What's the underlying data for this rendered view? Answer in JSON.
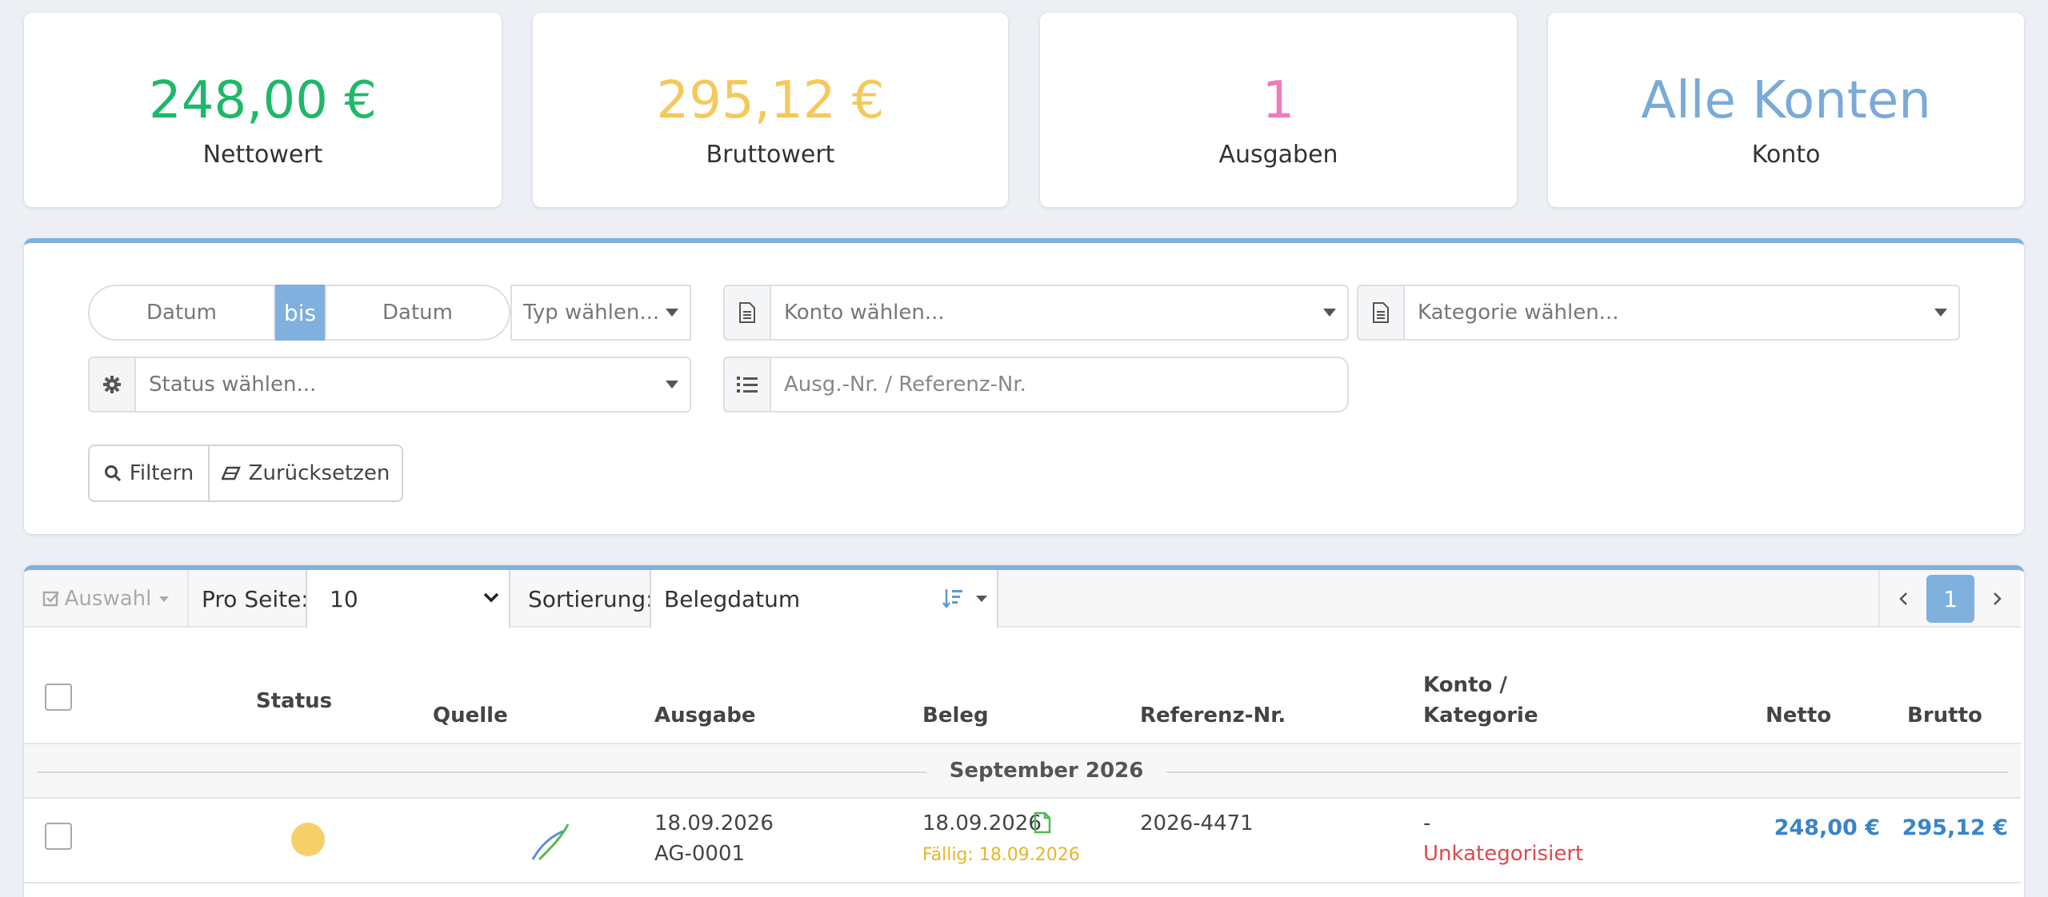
{
  "stats": [
    {
      "value": "248,00 €",
      "label": "Nettowert",
      "color": "#1eb86a"
    },
    {
      "value": "295,12 €",
      "label": "Bruttowert",
      "color": "#f5c85a"
    },
    {
      "value": "1",
      "label": "Ausgaben",
      "color": "#f07ab5"
    },
    {
      "value": "Alle Konten",
      "label": "Konto",
      "color": "#7aaad8"
    }
  ],
  "filters": {
    "date_from_placeholder": "Datum",
    "bis_label": "bis",
    "date_to_placeholder": "Datum",
    "type_select": "Typ wählen...",
    "account_select": "Konto wählen...",
    "category_select": "Kategorie wählen...",
    "status_select": "Status wählen...",
    "reference_placeholder": "Ausg.-Nr. / Referenz-Nr.",
    "filter_button": "Filtern",
    "reset_button": "Zurücksetzen"
  },
  "toolbar": {
    "selection_label": "Auswahl",
    "per_page_label": "Pro Seite:",
    "per_page_value": "10",
    "sort_label": "Sortierung:",
    "sort_value": "Belegdatum",
    "current_page": "1"
  },
  "table": {
    "headers": {
      "status": "Status",
      "source": "Quelle",
      "expense": "Ausgabe",
      "receipt": "Beleg",
      "reference": "Referenz-Nr.",
      "account_line1": "Konto /",
      "account_line2": "Kategorie",
      "net": "Netto",
      "gross": "Brutto"
    },
    "group_label": "September 2026",
    "rows": [
      {
        "status_color": "#f5d06a",
        "expense_date": "18.09.2026",
        "expense_number": "AG-0001",
        "receipt_date": "18.09.2026",
        "due": "Fällig: 18.09.2026",
        "reference": "2026-4471",
        "account": "-",
        "category": "Unkategorisiert",
        "net": "248,00 €",
        "gross": "295,12 €"
      }
    ]
  }
}
